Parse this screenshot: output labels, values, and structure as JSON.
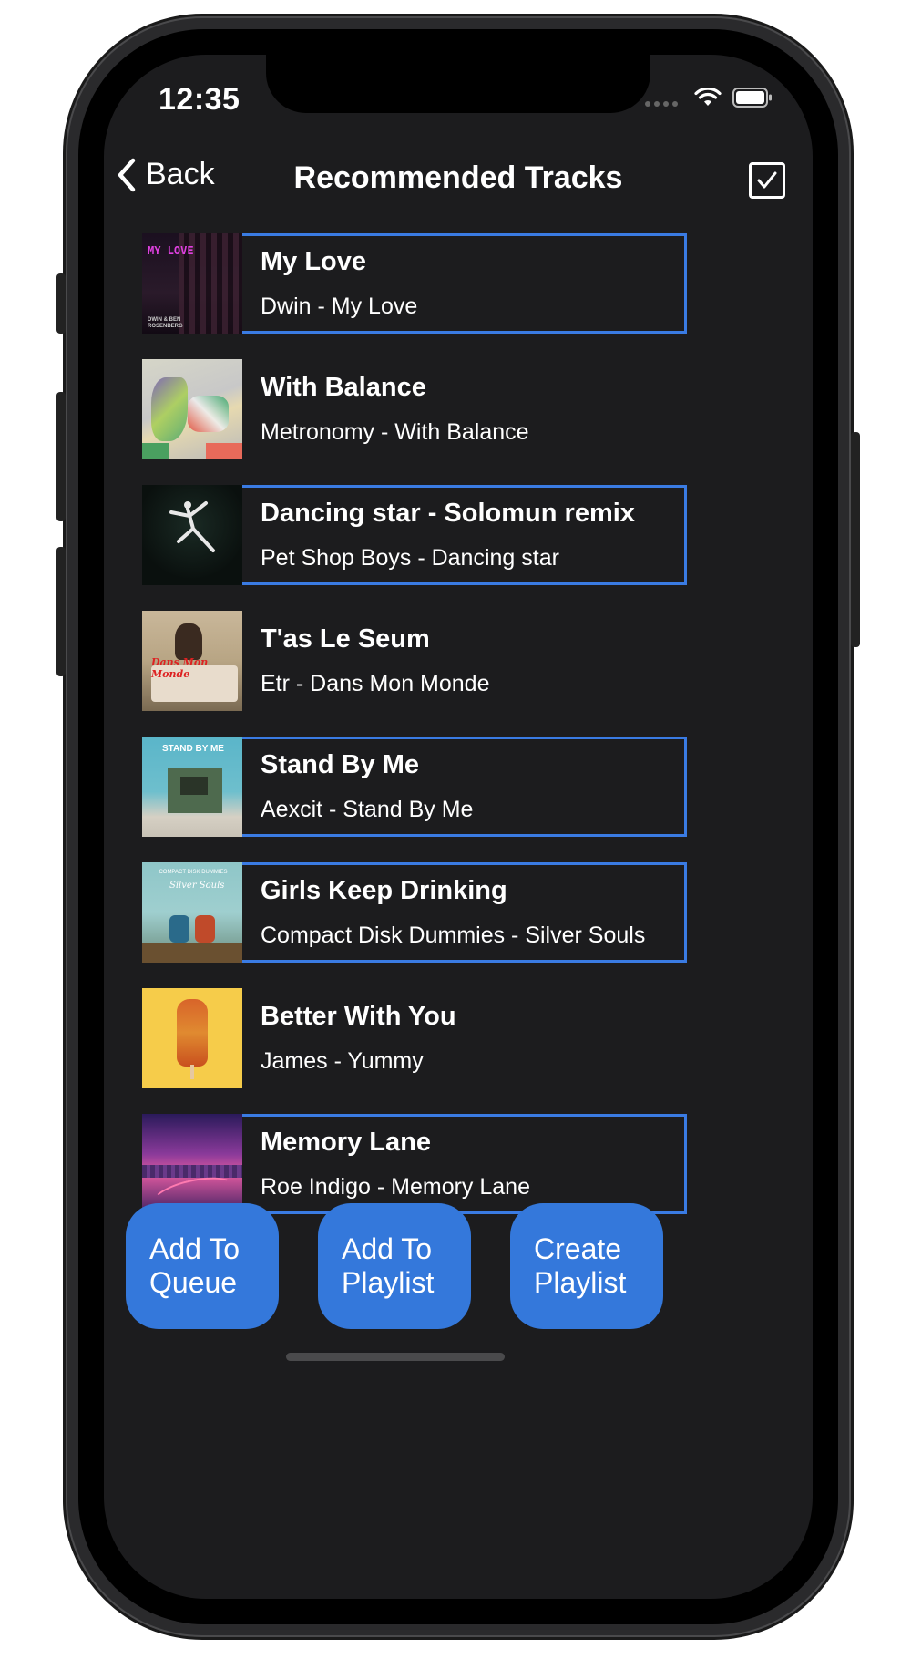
{
  "status_bar": {
    "time": "12:35"
  },
  "nav": {
    "back_label": "Back",
    "title": "Recommended Tracks"
  },
  "tracks": [
    {
      "title": "My Love",
      "subtitle": "Dwin - My Love",
      "selected": true,
      "art_text": "MY LOVE",
      "art_caption": "DWIN & BEN ROSENBERG"
    },
    {
      "title": "With Balance",
      "subtitle": "Metronomy - With Balance",
      "selected": false
    },
    {
      "title": "Dancing star - Solomun remix",
      "subtitle": "Pet Shop Boys - Dancing star",
      "selected": true
    },
    {
      "title": "T'as Le Seum",
      "subtitle": "Etr - Dans Mon Monde",
      "selected": false,
      "art_text": "Dans Mon Monde"
    },
    {
      "title": "Stand By Me",
      "subtitle": "Aexcit - Stand By Me",
      "selected": true,
      "art_text": "STAND BY ME"
    },
    {
      "title": "Girls Keep Drinking",
      "subtitle": "Compact Disk Dummies - Silver Souls",
      "selected": true,
      "art_text": "COMPACT DISK DUMMIES",
      "art_caption": "Silver Souls"
    },
    {
      "title": "Better With You",
      "subtitle": "James - Yummy",
      "selected": false
    },
    {
      "title": "Memory Lane",
      "subtitle": "Roe Indigo - Memory Lane",
      "selected": true
    }
  ],
  "actions": {
    "add_to_queue": "Add To Queue",
    "add_to_playlist": "Add To Playlist",
    "create_playlist": "Create Playlist"
  },
  "colors": {
    "background": "#1c1c1e",
    "accent": "#3478db",
    "selection_border": "#3a7be3"
  },
  "icons": [
    "chevron-left-icon",
    "checkbox-checked-icon",
    "wifi-icon",
    "battery-icon"
  ]
}
